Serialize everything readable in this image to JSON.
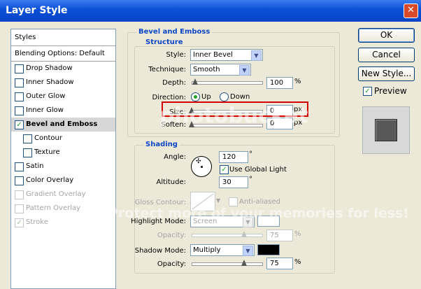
{
  "window": {
    "title": "Layer Style",
    "close": "✕"
  },
  "styles_list": {
    "header": "Styles",
    "blending": "Blending Options: Default",
    "items": [
      {
        "label": "Drop Shadow",
        "checked": false,
        "disabled": false,
        "indent": false
      },
      {
        "label": "Inner Shadow",
        "checked": false,
        "disabled": false,
        "indent": false
      },
      {
        "label": "Outer Glow",
        "checked": false,
        "disabled": false,
        "indent": false
      },
      {
        "label": "Inner Glow",
        "checked": false,
        "disabled": false,
        "indent": false
      },
      {
        "label": "Bevel and Emboss",
        "checked": true,
        "disabled": false,
        "indent": false,
        "selected": true
      },
      {
        "label": "Contour",
        "checked": false,
        "disabled": false,
        "indent": true
      },
      {
        "label": "Texture",
        "checked": false,
        "disabled": false,
        "indent": true
      },
      {
        "label": "Satin",
        "checked": false,
        "disabled": false,
        "indent": false
      },
      {
        "label": "Color Overlay",
        "checked": false,
        "disabled": false,
        "indent": false
      },
      {
        "label": "Gradient Overlay",
        "checked": false,
        "disabled": true,
        "indent": false
      },
      {
        "label": "Pattern Overlay",
        "checked": false,
        "disabled": true,
        "indent": false
      },
      {
        "label": "Stroke",
        "checked": true,
        "disabled": true,
        "indent": false
      }
    ]
  },
  "bevel": {
    "group_title": "Bevel and Emboss",
    "structure_title": "Structure",
    "style_label": "Style:",
    "style_value": "Inner Bevel",
    "technique_label": "Technique:",
    "technique_value": "Smooth",
    "depth_label": "Depth:",
    "depth_value": "100",
    "depth_unit": "%",
    "depth_level": 0.05,
    "direction_label": "Direction:",
    "direction_up": "Up",
    "direction_down": "Down",
    "size_label": "Size:",
    "size_value": "0",
    "size_unit": "px",
    "size_level": 0.0,
    "soften_label": "Soften:",
    "soften_value": "0",
    "soften_unit": "px",
    "soften_level": 0.0
  },
  "shading": {
    "title": "Shading",
    "angle_label": "Angle:",
    "angle_value": "120",
    "angle_unit": "°",
    "global_light_label": "Use Global Light",
    "altitude_label": "Altitude:",
    "altitude_value": "30",
    "altitude_unit": "°",
    "gloss_label": "Gloss Contour:",
    "anti_aliased_label": "Anti-aliased",
    "highlight_label": "Highlight Mode:",
    "highlight_value": "Screen",
    "highlight_color": "#ffffff",
    "hl_opacity_label": "Opacity:",
    "hl_opacity_value": "75",
    "hl_opacity_unit": "%",
    "hl_opacity_level": 0.75,
    "shadow_label": "Shadow Mode:",
    "shadow_value": "Multiply",
    "shadow_color": "#000000",
    "sh_opacity_label": "Opacity:",
    "sh_opacity_value": "75",
    "sh_opacity_unit": "%",
    "sh_opacity_level": 0.75
  },
  "buttons": {
    "ok": "OK",
    "cancel": "Cancel",
    "new_style": "New Style...",
    "preview": "Preview"
  },
  "watermark": {
    "brand": "photobucket",
    "tagline": "Protect more of your memories for less!"
  },
  "colors": {
    "title_bar": "#0a4fd6",
    "highlight_box": "#d40000",
    "group_title": "#0c46c8"
  }
}
